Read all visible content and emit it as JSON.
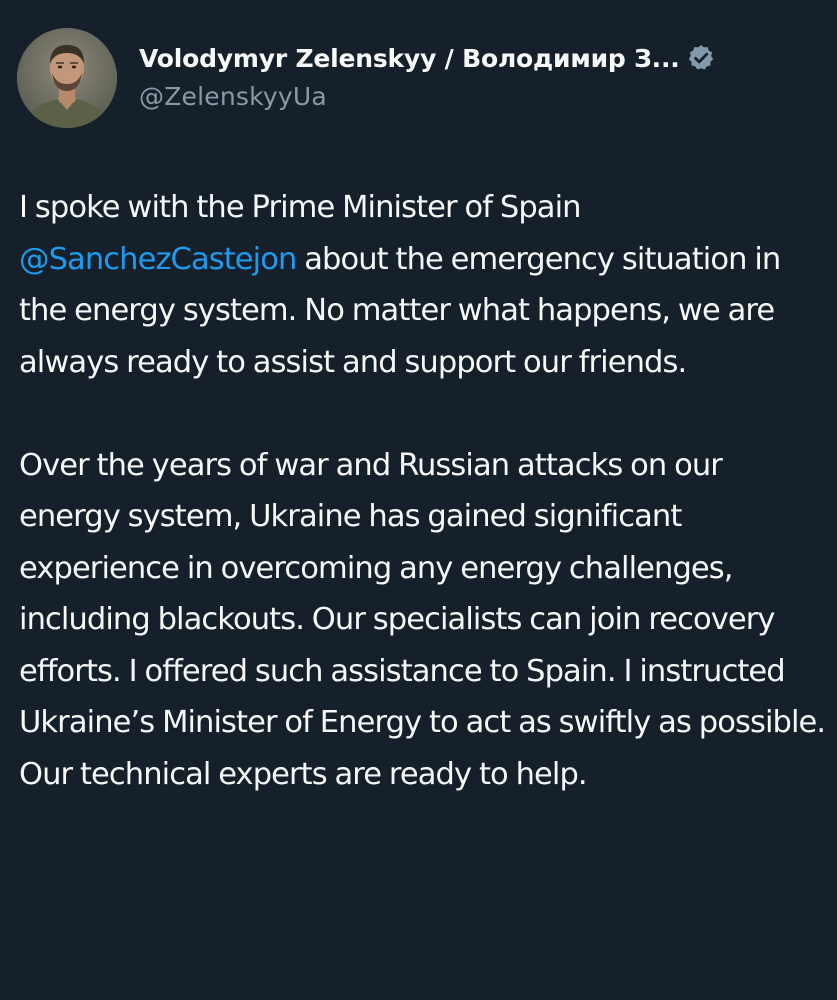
{
  "author": {
    "display_name": "Volodymyr Zelenskyy / Володимир З...",
    "handle": "@ZelenskyyUa",
    "avatar_icon": "profile-photo",
    "verified_icon": "verified-badge-icon"
  },
  "tweet": {
    "paragraph1": {
      "before": "I spoke with the Prime Minister of Spain ",
      "mention": "@SanchezCastejon",
      "after": " about the emergency situation in the energy system. No matter what happens, we are always ready to assist and support our friends."
    },
    "paragraph2": "Over the years of war and Russian attacks on our energy system, Ukraine has gained significant experience in overcoming any energy challenges, including blackouts. Our specialists can join recovery efforts. I offered such assistance to Spain. I instructed Ukraine’s Minister of Energy to act as swiftly as possible. Our technical experts are ready to help."
  },
  "colors": {
    "background": "#15202b",
    "text": "#f7f9f9",
    "secondary_text": "#8b98a5",
    "link": "#1d9bf0"
  }
}
